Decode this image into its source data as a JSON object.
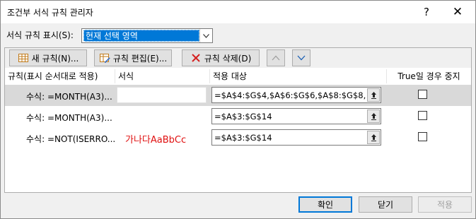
{
  "window": {
    "title": "조건부 서식 규칙 관리자",
    "help": "?",
    "close": "✕"
  },
  "show_rules": {
    "label": "서식 규칙 표시(S):",
    "selected": "현재 선택 영역"
  },
  "toolbar": {
    "new_rule": "새 규칙(N)...",
    "edit_rule": "규칙 편집(E)...",
    "delete_rule": "규칙 삭제(D)",
    "move_up": "⌃",
    "move_down": "⌄"
  },
  "table": {
    "headers": {
      "rule": "규칙(표시 순서대로 적용)",
      "format": "서식",
      "applies_to": "적용 대상",
      "stop_if_true": "True일 경우 중지"
    },
    "rows": [
      {
        "rule": "수식: =MONTH(A3)...",
        "format_preview": "",
        "applies_to": "=$A$4:$G$4,$A$6:$G$6,$A$8:$G$8,$A",
        "stop": false,
        "selected": true
      },
      {
        "rule": "수식: =MONTH(A3)...",
        "format_preview": "",
        "applies_to": "=$A$3:$G$14",
        "stop": false,
        "selected": false
      },
      {
        "rule": "수식: =NOT(ISERRO...",
        "format_preview": "가나다AaBbCc",
        "applies_to": "=$A$3:$G$14",
        "stop": false,
        "selected": false
      }
    ]
  },
  "footer": {
    "ok": "확인",
    "close": "닫기",
    "apply": "적용"
  },
  "colors": {
    "accent": "#0078d7",
    "format_preview_text": "#e01010",
    "selected_row": "#d9d9d9"
  }
}
